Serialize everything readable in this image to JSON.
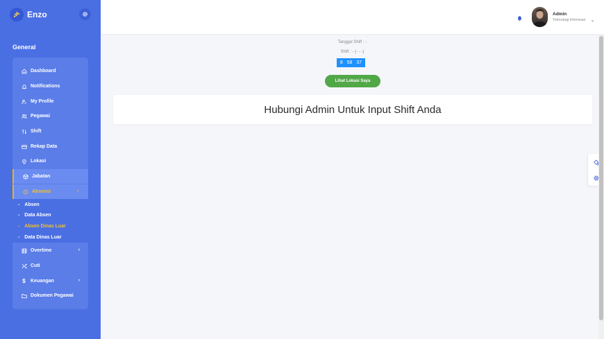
{
  "brand": {
    "logo_text": "ታ",
    "name": "Enzo"
  },
  "sidebar": {
    "section_title": "General",
    "items": [
      {
        "label": "Dashboard",
        "icon": "home-icon"
      },
      {
        "label": "Notifications",
        "icon": "bell-icon"
      },
      {
        "label": "My Profile",
        "icon": "user-edit-icon"
      },
      {
        "label": "Pegawai",
        "icon": "users-icon"
      },
      {
        "label": "Shift",
        "icon": "swap-icon"
      },
      {
        "label": "Rekap Data",
        "icon": "card-icon"
      },
      {
        "label": "Lokasi",
        "icon": "location-icon"
      },
      {
        "label": "Jabatan",
        "icon": "box-icon"
      },
      {
        "label": "Absensi",
        "icon": "clock-icon",
        "arrow": "⌄"
      },
      {
        "label": "Overtime",
        "icon": "film-icon",
        "arrow": "›"
      },
      {
        "label": "Cuti",
        "icon": "shuffle-icon"
      },
      {
        "label": "Keuangan",
        "icon": "dollar-icon",
        "arrow": "›"
      },
      {
        "label": "Dokumen Pegawai",
        "icon": "folder-icon"
      }
    ],
    "subitems": [
      {
        "label": "Absen"
      },
      {
        "label": "Data Absen"
      },
      {
        "label": "Absen Dinas Luar"
      },
      {
        "label": "Data Dinas Luar"
      }
    ],
    "sub_prefix": "-"
  },
  "header": {
    "user_name": "Admin",
    "user_dept": "Teknologi Informasi",
    "user_chevron": "⌄"
  },
  "main": {
    "shift_date": "Tanggal Shift : -",
    "shift_line": "Shift : - (- - -)",
    "clock": {
      "h": "8",
      "m": "58",
      "s": "37"
    },
    "location_button": "Lihat Lokasi Saya",
    "notice": "Hubungi Admin Untuk Input Shift Anda"
  },
  "colors": {
    "sidebar": "#4a6fe3",
    "active": "#f2c233",
    "clock": "#1e90ff",
    "button": "#51a847"
  }
}
